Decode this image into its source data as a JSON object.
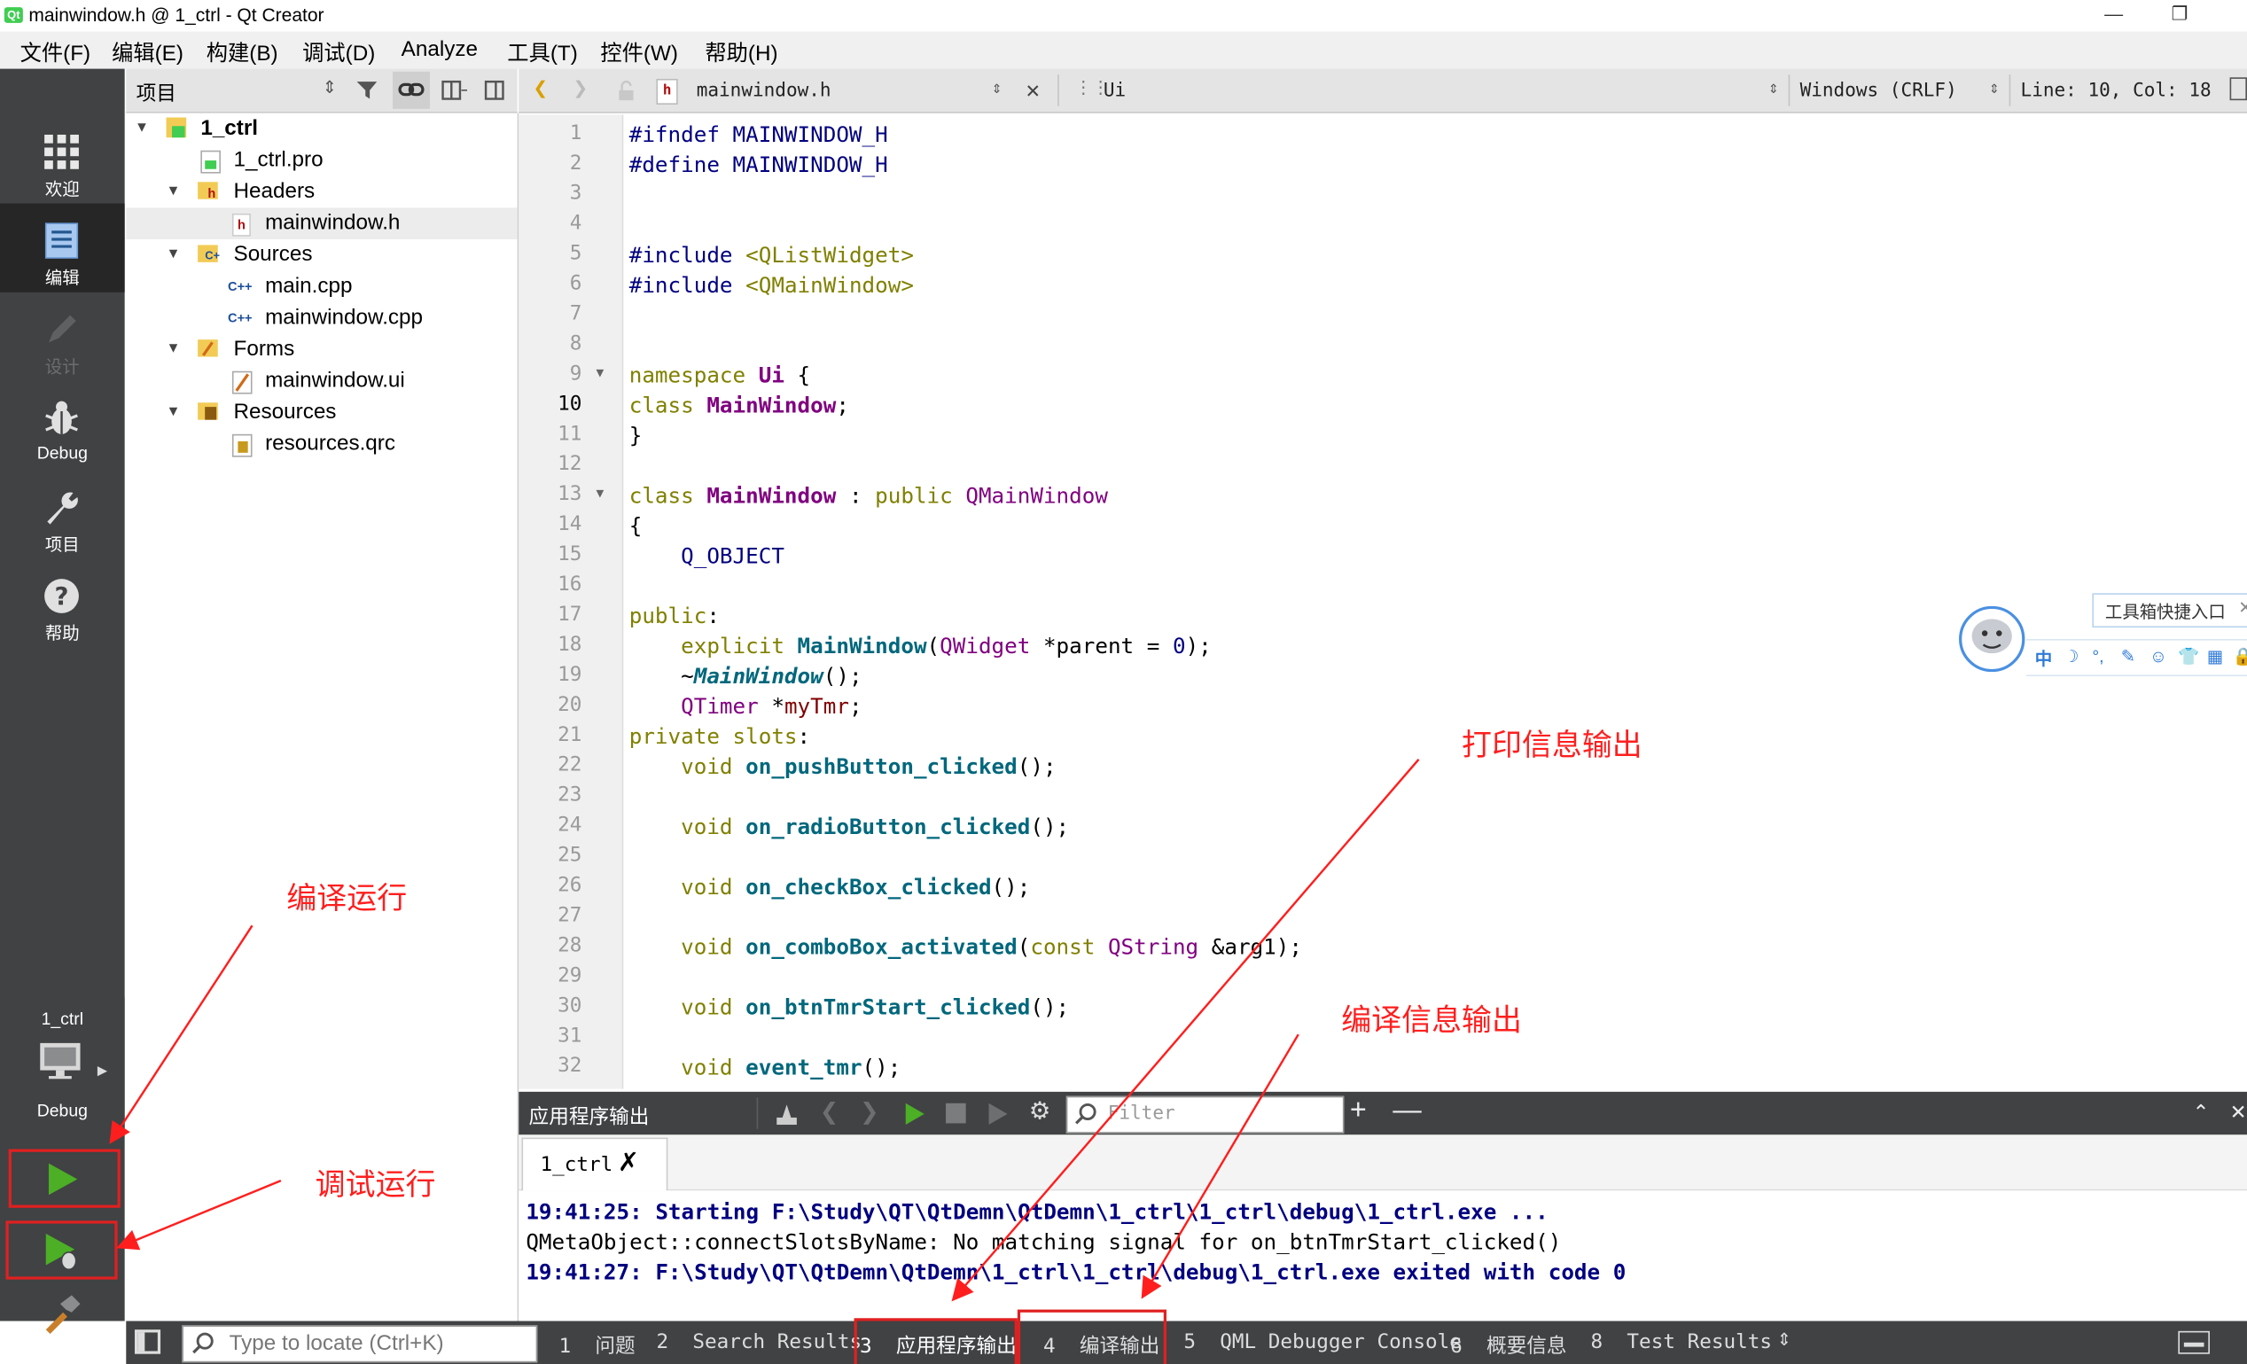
{
  "window": {
    "title": "mainwindow.h @ 1_ctrl - Qt Creator",
    "minimize_icon": "minimize-icon",
    "restore_icon": "restore-icon"
  },
  "menubar": {
    "items": [
      "文件(F)",
      "编辑(E)",
      "构建(B)",
      "调试(D)",
      "Analyze",
      "工具(T)",
      "控件(W)",
      "帮助(H)"
    ]
  },
  "modebar": {
    "modes": [
      {
        "label": "欢迎",
        "icon": "grid-icon"
      },
      {
        "label": "编辑",
        "icon": "document-icon",
        "active": true
      },
      {
        "label": "设计",
        "icon": "pencil-icon",
        "disabled": true
      },
      {
        "label": "Debug",
        "icon": "bug-icon"
      },
      {
        "label": "项目",
        "icon": "wrench-icon"
      },
      {
        "label": "帮助",
        "icon": "help-icon"
      }
    ],
    "kit": {
      "project": "1_ctrl",
      "config": "Debug"
    }
  },
  "project_panel": {
    "selector": "项目",
    "tree": [
      {
        "label": "1_ctrl",
        "level": 0,
        "expanded": true,
        "bold": true,
        "icon": "qt-project-icon"
      },
      {
        "label": "1_ctrl.pro",
        "level": 1,
        "icon": "pro-file-icon"
      },
      {
        "label": "Headers",
        "level": 1,
        "expanded": true,
        "icon": "headers-folder-icon"
      },
      {
        "label": "mainwindow.h",
        "level": 2,
        "selected": true,
        "icon": "header-file-icon"
      },
      {
        "label": "Sources",
        "level": 1,
        "expanded": true,
        "icon": "sources-folder-icon"
      },
      {
        "label": "main.cpp",
        "level": 2,
        "icon": "cpp-file-icon"
      },
      {
        "label": "mainwindow.cpp",
        "level": 2,
        "icon": "cpp-file-icon"
      },
      {
        "label": "Forms",
        "level": 1,
        "expanded": true,
        "icon": "forms-folder-icon"
      },
      {
        "label": "mainwindow.ui",
        "level": 2,
        "icon": "ui-file-icon"
      },
      {
        "label": "Resources",
        "level": 1,
        "expanded": true,
        "icon": "resources-folder-icon"
      },
      {
        "label": "resources.qrc",
        "level": 2,
        "icon": "qrc-file-icon"
      }
    ]
  },
  "editor_toolbar": {
    "file": "mainwindow.h",
    "symbol": "Ui",
    "encoding": "Windows (CRLF)",
    "position": "Line: 10, Col: 18"
  },
  "editor": {
    "current_line": 10,
    "line_numbers": [
      "1",
      "2",
      "3",
      "4",
      "5",
      "6",
      "7",
      "8",
      "9",
      "10",
      "11",
      "12",
      "13",
      "14",
      "15",
      "16",
      "17",
      "18",
      "19",
      "20",
      "21",
      "22",
      "23",
      "24",
      "25",
      "26",
      "27",
      "28",
      "29",
      "30",
      "31",
      "32"
    ],
    "code": {
      "l1a": "#ifndef",
      "l1b": " MAINWINDOW_H",
      "l2a": "#define",
      "l2b": " MAINWINDOW_H",
      "l5a": "#include",
      "l5b": " <QListWidget>",
      "l6a": "#include",
      "l6b": " <QMainWindow>",
      "l9a": "namespace",
      "l9b": " Ui",
      "l9c": " {",
      "l10a": "class",
      "l10b": " MainWindow",
      "l10c": ";",
      "l11": "}",
      "l13a": "class",
      "l13b": " MainWindow",
      "l13c": " : ",
      "l13d": "public",
      "l13e": " QMainWindow",
      "l14": "{",
      "l15": "    Q_OBJECT",
      "l17a": "public",
      "l17b": ":",
      "l18a": "    explicit",
      "l18b": " MainWindow",
      "l18c": "(",
      "l18d": "QWidget",
      "l18e": " *",
      "l18f": "parent",
      "l18g": " = ",
      "l18h": "0",
      "l18i": ");",
      "l19a": "    ~",
      "l19b": "MainWindow",
      "l19c": "();",
      "l20a": "    ",
      "l20b": "QTimer",
      "l20c": " *",
      "l20d": "myTmr",
      "l20e": ";",
      "l21a": "private",
      "l21b": " slots",
      "l21c": ":",
      "l22a": "    void",
      "l22b": " on_pushButton_clicked",
      "l22c": "();",
      "l24a": "    void",
      "l24b": " on_radioButton_clicked",
      "l24c": "();",
      "l26a": "    void",
      "l26b": " on_checkBox_clicked",
      "l26c": "();",
      "l28a": "    void",
      "l28b": " on_comboBox_activated",
      "l28c": "(",
      "l28d": "const",
      "l28e": " QString",
      "l28f": " &arg1);",
      "l30a": "    void",
      "l30b": " on_btnTmrStart_clicked",
      "l30c": "();",
      "l32a": "    void",
      "l32b": " event_tmr",
      "l32c": "();"
    }
  },
  "floating_toolbox": {
    "label": "工具箱快捷入口",
    "ime_chars": [
      "中",
      "☽",
      "°,",
      "✎",
      "☺",
      "👕",
      "▦",
      "🔒"
    ]
  },
  "output_pane": {
    "title": "应用程序输出",
    "filter_placeholder": "Filter",
    "tab": "1_ctrl",
    "lines": [
      "19:41:25: Starting F:\\Study\\QT\\QtDemn\\QtDemn\\1_ctrl\\1_ctrl\\debug\\1_ctrl.exe ...",
      "QMetaObject::connectSlotsByName: No matching signal for on_btnTmrStart_clicked()",
      "19:41:27: F:\\Study\\QT\\QtDemn\\QtDemn\\1_ctrl\\1_ctrl\\debug\\1_ctrl.exe exited with code 0"
    ]
  },
  "statusbar": {
    "locator_placeholder": "Type to locate (Ctrl+K)",
    "tabs": [
      {
        "num": "1",
        "label": "问题"
      },
      {
        "num": "2",
        "label": "Search Results"
      },
      {
        "num": "3",
        "label": "应用程序输出"
      },
      {
        "num": "4",
        "label": "编译输出"
      },
      {
        "num": "5",
        "label": "QML Debugger Console"
      },
      {
        "num": "6",
        "label": "概要信息"
      },
      {
        "num": "8",
        "label": "Test Results"
      }
    ]
  },
  "annotations": {
    "compile_run": "编译运行",
    "debug_run": "调试运行",
    "print_output": "打印信息输出",
    "compile_output": "编译信息输出"
  },
  "colors": {
    "accent_red": "#ff1e1e",
    "mode_bar": "#404244",
    "keyword": "#808000",
    "preprocessor": "#000080",
    "type": "#800080",
    "function": "#00677c",
    "run_green": "#4caf25"
  }
}
